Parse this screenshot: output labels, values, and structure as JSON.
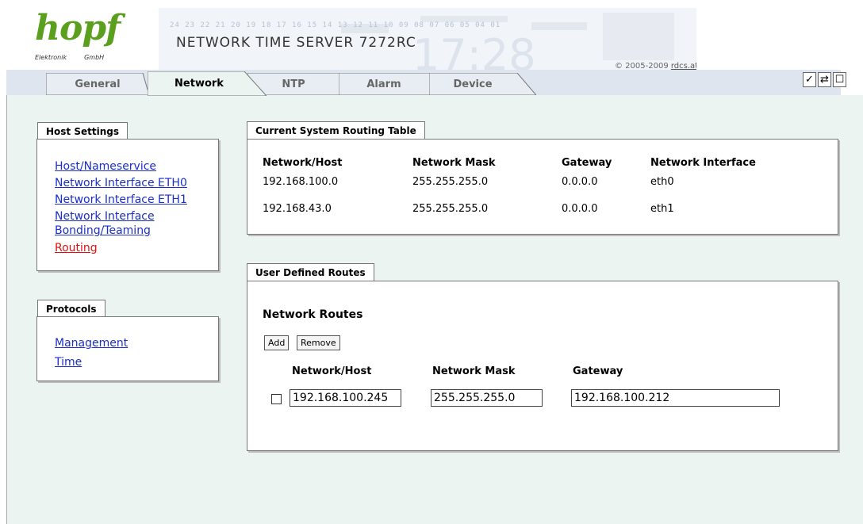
{
  "header": {
    "logo_word": "hopf",
    "logo_sub_left": "Elektronik",
    "logo_sub_right": "GmbH",
    "banner_digits": "24 23 22 21 20 19 18 17 16 15 14 13 12 11 10 09 08 07 06 05 04 01",
    "title": "NETWORK TIME SERVER 7272RC",
    "copyright_prefix": "© 2005-2009 ",
    "copyright_link": "rdcs.at"
  },
  "tabs": [
    "General",
    "Network",
    "NTP",
    "Alarm",
    "Device"
  ],
  "active_tab": "Network",
  "tools": [
    {
      "icon": "check-icon",
      "glyph": "✓"
    },
    {
      "icon": "refresh-icon",
      "glyph": "⇄"
    },
    {
      "icon": "window-icon",
      "glyph": "☐"
    }
  ],
  "host_settings": {
    "title": "Host Settings",
    "links": [
      {
        "label": "Host/Nameservice"
      },
      {
        "label": "Network Interface ETH0"
      },
      {
        "label": "Network Interface ETH1"
      },
      {
        "label": "Network Interface Bonding/Teaming"
      },
      {
        "label": "Routing",
        "active": true
      }
    ]
  },
  "protocols": {
    "title": "Protocols",
    "links": [
      {
        "label": "Management"
      },
      {
        "label": "Time"
      }
    ]
  },
  "routing_table": {
    "title": "Current System Routing Table",
    "columns": [
      "Network/Host",
      "Network Mask",
      "Gateway",
      "Network Interface"
    ],
    "rows": [
      [
        "192.168.100.0",
        "255.255.255.0",
        "0.0.0.0",
        "eth0"
      ],
      [
        "192.168.43.0",
        "255.255.255.0",
        "0.0.0.0",
        "eth1"
      ]
    ]
  },
  "user_routes": {
    "title": "User Defined Routes",
    "section_title": "Network Routes",
    "add_label": "Add",
    "remove_label": "Remove",
    "columns": [
      "Network/Host",
      "Network Mask",
      "Gateway"
    ],
    "rows": [
      {
        "checked": false,
        "host": "192.168.100.245",
        "mask": "255.255.255.0",
        "gateway": "192.168.100.212"
      }
    ]
  },
  "colors": {
    "logo_green": "#5aa01e",
    "link_blue": "#1a2fc7",
    "link_active_red": "#e01010",
    "content_bg": "#ecf4f1",
    "tabbar_bg": "#dfe5ee"
  }
}
